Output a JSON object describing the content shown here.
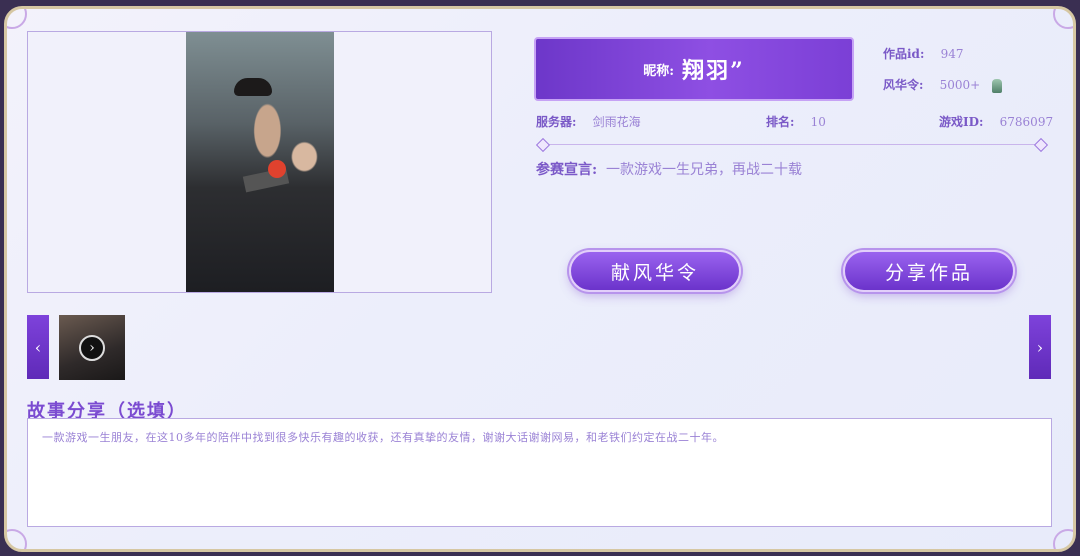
{
  "profile": {
    "nickname_label": "昵称:",
    "nickname": "翔羽”",
    "work_id_label": "作品id:",
    "work_id": "947",
    "fenghua_label": "风华令:",
    "fenghua_value": "5000+",
    "server_label": "服务器:",
    "server": "剑雨花海",
    "rank_label": "排名:",
    "rank": "10",
    "game_id_label": "游戏ID:",
    "game_id": "6786097",
    "declaration_label": "参赛宣言:",
    "declaration": "一款游戏一生兄弟，再战二十载"
  },
  "buttons": {
    "donate": "献风华令",
    "share": "分享作品"
  },
  "gallery": {
    "prev": "‹",
    "next": "›",
    "play": "›"
  },
  "story": {
    "title": "故事分享（选填）",
    "text": "一款游戏一生朋友，在这10多年的陪伴中找到很多快乐有趣的收获，还有真挚的友情，谢谢大话谢谢网易，和老铁们约定在战二十年。"
  },
  "icons": {
    "token": "jade-token-icon",
    "play": "play-icon"
  },
  "colors": {
    "accent": "#7b3fd6",
    "text": "#9a82d5"
  }
}
